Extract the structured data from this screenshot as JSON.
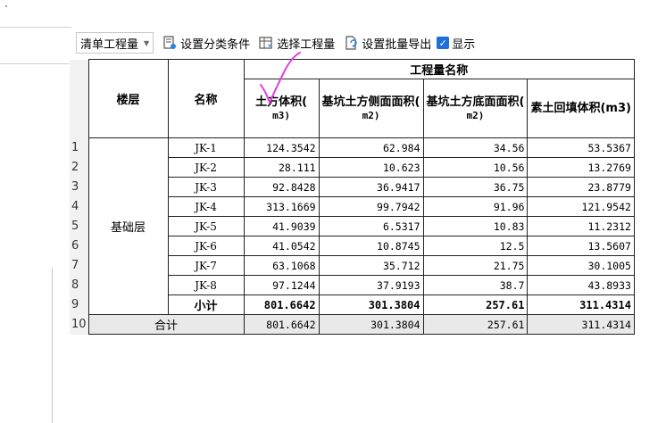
{
  "toolbar": {
    "mode_select": "清单工程量",
    "set_classification": "设置分类条件",
    "select_quantity": "选择工程量",
    "batch_export": "设置批量导出",
    "show_checkbox": "显示",
    "show_checked": true
  },
  "table": {
    "header": {
      "floor": "楼层",
      "name": "名称",
      "group": "工程量名称",
      "columns": [
        {
          "label": "土方体积(",
          "unit": "m3)"
        },
        {
          "label": "基坑土方侧面面积(",
          "unit": "m2)"
        },
        {
          "label": "基坑土方底面面积(",
          "unit": "m2)"
        },
        {
          "label": "素土回填体积(m3)",
          "unit": ""
        }
      ]
    },
    "floor_value": "基础层",
    "rows": [
      {
        "n": "1",
        "name": "JK-1",
        "v": [
          "124.3542",
          "62.984",
          "34.56",
          "53.5367"
        ]
      },
      {
        "n": "2",
        "name": "JK-2",
        "v": [
          "28.111",
          "10.623",
          "10.56",
          "13.2769"
        ]
      },
      {
        "n": "3",
        "name": "JK-3",
        "v": [
          "92.8428",
          "36.9417",
          "36.75",
          "23.8779"
        ]
      },
      {
        "n": "4",
        "name": "JK-4",
        "v": [
          "313.1669",
          "99.7942",
          "91.96",
          "121.9542"
        ]
      },
      {
        "n": "5",
        "name": "JK-5",
        "v": [
          "41.9039",
          "6.5317",
          "10.83",
          "11.2312"
        ]
      },
      {
        "n": "6",
        "name": "JK-6",
        "v": [
          "41.0542",
          "10.8745",
          "12.5",
          "13.5607"
        ]
      },
      {
        "n": "7",
        "name": "JK-7",
        "v": [
          "63.1068",
          "35.712",
          "21.75",
          "30.1005"
        ]
      },
      {
        "n": "8",
        "name": "JK-8",
        "v": [
          "97.1244",
          "37.9193",
          "38.7",
          "43.8933"
        ]
      }
    ],
    "subtotal": {
      "n": "9",
      "label": "小计",
      "v": [
        "801.6642",
        "301.3804",
        "257.61",
        "311.4314"
      ]
    },
    "total": {
      "n": "10",
      "label": "合计",
      "v": [
        "801.6642",
        "301.3804",
        "257.61",
        "311.4314"
      ]
    }
  },
  "colors": {
    "accent": "#1e70d8",
    "annotation": "#e23fe0"
  }
}
